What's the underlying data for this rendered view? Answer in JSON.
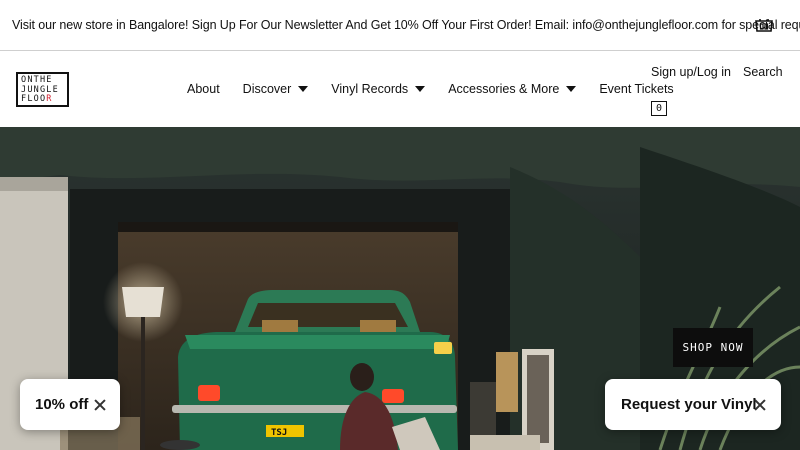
{
  "announcement": {
    "text": "Visit our new store in Bangalore! Sign Up For Our Newsletter And Get 10% Off Your First Order! Email: info@onthejunglefloor.com for special requests!"
  },
  "logo": {
    "line1": "ONTHE",
    "line2": "JUNGLE",
    "line3_main": "FLOO",
    "line3_accent": "R"
  },
  "nav": {
    "items": [
      {
        "label": "About",
        "dropdown": false
      },
      {
        "label": "Discover",
        "dropdown": true
      },
      {
        "label": "Vinyl Records",
        "dropdown": true
      },
      {
        "label": "Accessories & More",
        "dropdown": true
      },
      {
        "label": "Event Tickets",
        "dropdown": false
      }
    ]
  },
  "account": {
    "signup_label": "Sign up/Log in",
    "search_label": "Search",
    "cart_count": "0"
  },
  "hero": {
    "cta_label": "SHOP NOW",
    "license_plate": "TSJ"
  },
  "popups": {
    "discount_label": "10% off",
    "request_label": "Request your Vinyl"
  },
  "colors": {
    "logo_accent": "#d21f2f",
    "cta_background": "#0d0d0d",
    "car_green": "#1f6b4a"
  }
}
